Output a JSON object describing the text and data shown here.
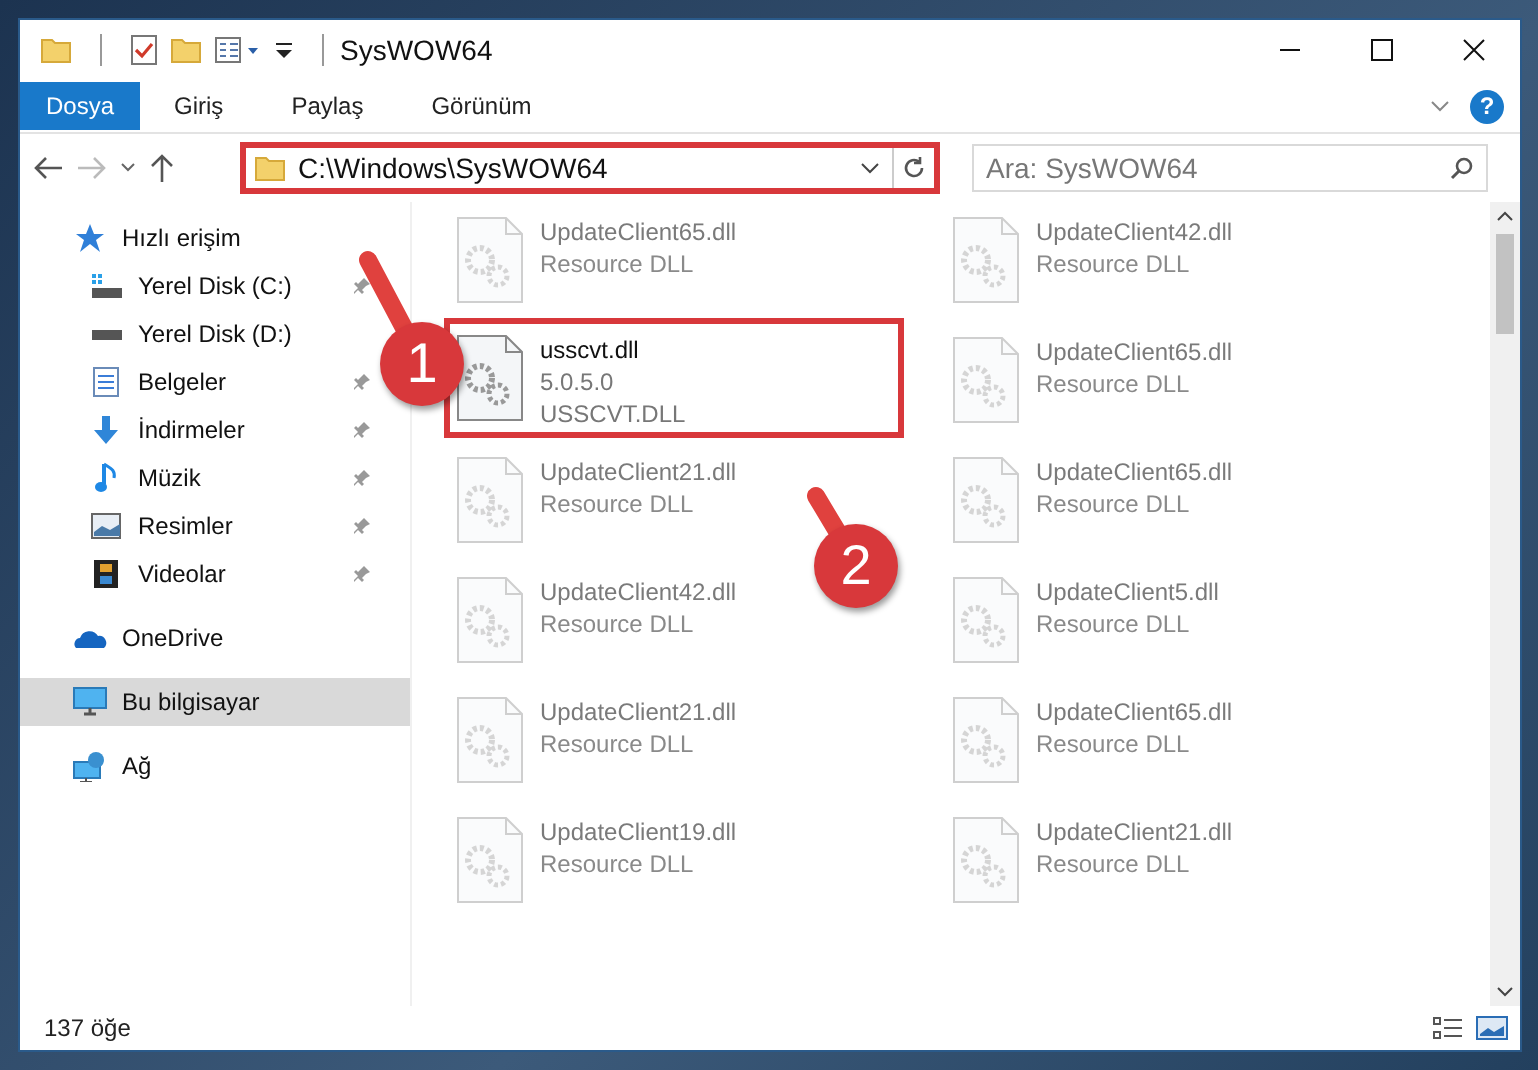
{
  "window": {
    "title": "SysWOW64"
  },
  "ribbon": {
    "tabs": [
      {
        "label": "Dosya",
        "selected": true
      },
      {
        "label": "Giriş",
        "selected": false
      },
      {
        "label": "Paylaş",
        "selected": false
      },
      {
        "label": "Görünüm",
        "selected": false
      }
    ],
    "help": "?"
  },
  "address_bar": {
    "path": "C:\\Windows\\SysWOW64",
    "highlighted": true
  },
  "search": {
    "placeholder": "Ara: SysWOW64"
  },
  "navigation": {
    "items": [
      {
        "label": "Hızlı erişim",
        "selected": false,
        "children": [
          {
            "label": "Yerel Disk (C:)",
            "pinned": true
          },
          {
            "label": "Yerel Disk (D:)",
            "pinned": false
          },
          {
            "label": "Belgeler",
            "pinned": true
          },
          {
            "label": "İndirmeler",
            "pinned": true
          },
          {
            "label": "Müzik",
            "pinned": true
          },
          {
            "label": "Resimler",
            "pinned": true
          },
          {
            "label": "Videolar",
            "pinned": true
          }
        ]
      },
      {
        "label": "OneDrive",
        "selected": false
      },
      {
        "label": "Bu bilgisayar",
        "selected": true
      },
      {
        "label": "Ağ",
        "selected": false
      }
    ]
  },
  "files": [
    {
      "name": "UpdateClient65.dll",
      "details": [
        "Resource DLL"
      ],
      "blurred": true,
      "highlighted": false
    },
    {
      "name": "UpdateClient42.dll",
      "details": [
        "Resource DLL"
      ],
      "blurred": true,
      "highlighted": false
    },
    {
      "name": "usscvt.dll",
      "details": [
        "5.0.5.0",
        "USSCVT.DLL"
      ],
      "blurred": false,
      "highlighted": true
    },
    {
      "name": "UpdateClient65.dll",
      "details": [
        "Resource DLL"
      ],
      "blurred": true,
      "highlighted": false
    },
    {
      "name": "UpdateClient21.dll",
      "details": [
        "Resource DLL"
      ],
      "blurred": true,
      "highlighted": false
    },
    {
      "name": "UpdateClient65.dll",
      "details": [
        "Resource DLL"
      ],
      "blurred": true,
      "highlighted": false
    },
    {
      "name": "UpdateClient42.dll",
      "details": [
        "Resource DLL"
      ],
      "blurred": true,
      "highlighted": false
    },
    {
      "name": "UpdateClient5.dll",
      "details": [
        "Resource DLL"
      ],
      "blurred": true,
      "highlighted": false
    },
    {
      "name": "UpdateClient21.dll",
      "details": [
        "Resource DLL"
      ],
      "blurred": true,
      "highlighted": false
    },
    {
      "name": "UpdateClient65.dll",
      "details": [
        "Resource DLL"
      ],
      "blurred": true,
      "highlighted": false
    },
    {
      "name": "UpdateClient19.dll",
      "details": [
        "Resource DLL"
      ],
      "blurred": true,
      "highlighted": false
    },
    {
      "name": "UpdateClient21.dll",
      "details": [
        "Resource DLL"
      ],
      "blurred": true,
      "highlighted": false
    }
  ],
  "status_bar": {
    "item_count": "137 öğe"
  },
  "annotations": [
    {
      "number": "1"
    },
    {
      "number": "2"
    }
  ]
}
